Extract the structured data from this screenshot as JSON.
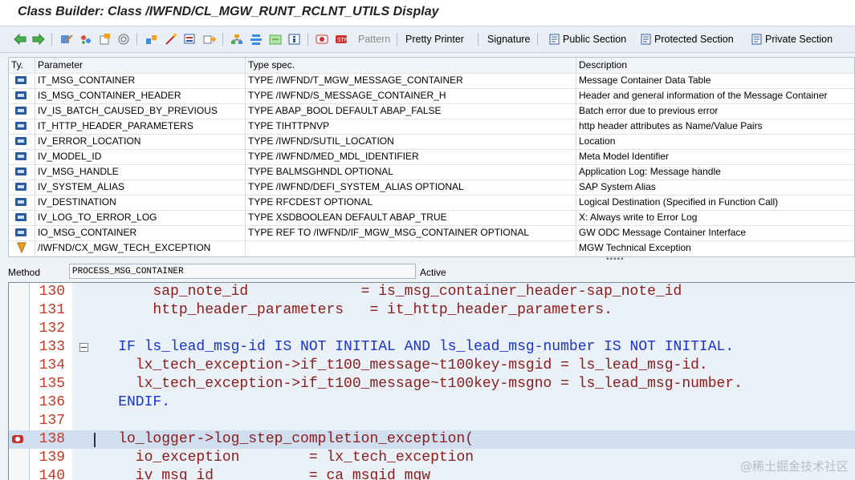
{
  "window": {
    "title": "Class Builder: Class /IWFND/CL_MGW_RUNT_RCLNT_UTILS Display"
  },
  "toolbar": {
    "icons": [
      "back-icon",
      "forward-icon",
      "other-object-icon",
      "display-change-icon",
      "active-inactive-icon",
      "where-used-icon",
      "check-icon",
      "activate-icon",
      "test-icon",
      "object-list-icon",
      "navigation-window-icon",
      "hierarchy-icon",
      "mark-icon",
      "enhance-icon",
      "breakpoint-icon",
      "session-breakpoint-icon"
    ],
    "pattern_label": "Pattern",
    "pretty_printer_label": "Pretty Printer",
    "signature_label": "Signature",
    "public_section_label": "Public Section",
    "protected_section_label": "Protected Section",
    "private_section_label": "Private Section"
  },
  "params": {
    "columns": {
      "type": "Ty.",
      "parameter": "Parameter",
      "typespec": "Type spec.",
      "description": "Description"
    },
    "rows": [
      {
        "icon": "importing-param-icon",
        "parameter": "IT_MSG_CONTAINER",
        "typespec": "TYPE /IWFND/T_MGW_MESSAGE_CONTAINER",
        "description": "Message Container Data Table"
      },
      {
        "icon": "importing-param-icon",
        "parameter": "IS_MSG_CONTAINER_HEADER",
        "typespec": "TYPE /IWFND/S_MESSAGE_CONTAINER_H",
        "description": "Header and general information of the Message Container"
      },
      {
        "icon": "importing-param-icon",
        "parameter": "IV_IS_BATCH_CAUSED_BY_PREVIOUS",
        "typespec": "TYPE ABAP_BOOL  DEFAULT ABAP_FALSE",
        "description": "Batch error due to previous error"
      },
      {
        "icon": "importing-param-icon",
        "parameter": "IT_HTTP_HEADER_PARAMETERS",
        "typespec": "TYPE TIHTTPNVP",
        "description": "http header attributes as Name/Value Pairs"
      },
      {
        "icon": "importing-param-icon",
        "parameter": "IV_ERROR_LOCATION",
        "typespec": "TYPE /IWFND/SUTIL_LOCATION",
        "description": "Location"
      },
      {
        "icon": "importing-param-icon",
        "parameter": "IV_MODEL_ID",
        "typespec": "TYPE /IWFND/MED_MDL_IDENTIFIER",
        "description": "Meta Model Identifier"
      },
      {
        "icon": "importing-param-icon",
        "parameter": "IV_MSG_HANDLE",
        "typespec": "TYPE BALMSGHNDL OPTIONAL",
        "description": "Application Log: Message handle"
      },
      {
        "icon": "importing-param-icon",
        "parameter": "IV_SYSTEM_ALIAS",
        "typespec": "TYPE /IWFND/DEFI_SYSTEM_ALIAS OPTIONAL",
        "description": "SAP System Alias"
      },
      {
        "icon": "importing-param-icon",
        "parameter": "IV_DESTINATION",
        "typespec": "TYPE RFCDEST OPTIONAL",
        "description": "Logical Destination (Specified in Function Call)"
      },
      {
        "icon": "importing-param-icon",
        "parameter": "IV_LOG_TO_ERROR_LOG",
        "typespec": "TYPE XSDBOOLEAN  DEFAULT ABAP_TRUE",
        "description": "X: Always write to Error Log"
      },
      {
        "icon": "importing-param-icon",
        "parameter": "IO_MSG_CONTAINER",
        "typespec": "TYPE REF TO /IWFND/IF_MGW_MSG_CONTAINER OPTIONAL",
        "description": "GW ODC Message Container Interface"
      },
      {
        "icon": "exception-icon",
        "parameter": "/IWFND/CX_MGW_TECH_EXCEPTION",
        "typespec": "",
        "description": "MGW Technical Exception"
      }
    ]
  },
  "method": {
    "label": "Method",
    "value": "PROCESS_MSG_CONTAINER",
    "status": "Active"
  },
  "editor": {
    "lines": [
      {
        "num": "130",
        "text": "        sap_note_id             = is_msg_container_header-sap_note_id"
      },
      {
        "num": "131",
        "text": "        http_header_parameters   = it_http_header_parameters."
      },
      {
        "num": "132",
        "text": ""
      },
      {
        "num": "133",
        "text": "    IF ls_lead_msg-id IS NOT INITIAL AND ls_lead_msg-number IS NOT INITIAL."
      },
      {
        "num": "134",
        "text": "      lx_tech_exception->if_t100_message~t100key-msgid = ls_lead_msg-id."
      },
      {
        "num": "135",
        "text": "      lx_tech_exception->if_t100_message~t100key-msgno = ls_lead_msg-number."
      },
      {
        "num": "136",
        "text": "    ENDIF."
      },
      {
        "num": "137",
        "text": ""
      },
      {
        "num": "138",
        "text": "    lo_logger->log_step_completion_exception("
      },
      {
        "num": "139",
        "text": "      io_exception        = lx_tech_exception"
      },
      {
        "num": "140",
        "text": "      iv_msg_id           = ca_msgid_mgw"
      }
    ]
  },
  "watermark": "@稀土掘金技术社区"
}
